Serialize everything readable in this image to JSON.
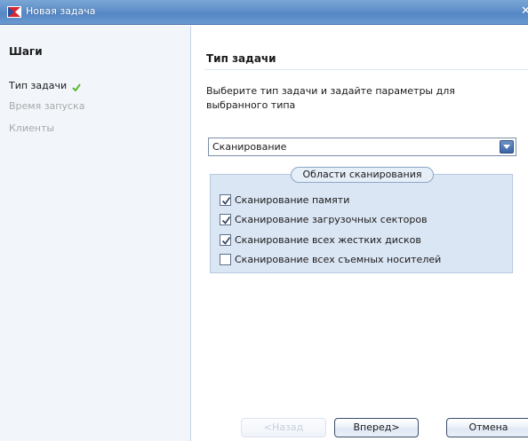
{
  "window": {
    "title": "Новая задача",
    "icon": "app-flag-icon"
  },
  "sidebar": {
    "title": "Шаги",
    "steps": [
      {
        "label": "Тип задачи",
        "state": "done",
        "icon": "checkmark-icon"
      },
      {
        "label": "Время запуска",
        "state": "disabled"
      },
      {
        "label": "Клиенты",
        "state": "disabled"
      }
    ]
  },
  "main": {
    "title": "Тип задачи",
    "description": "Выберите тип задачи и задайте параметры для выбранного типа",
    "task_type": {
      "selected": "Сканирование",
      "icon": "chevron-down-icon"
    },
    "scan_areas": {
      "legend": "Области сканирования",
      "options": [
        {
          "label": "Сканирование памяти",
          "checked": true
        },
        {
          "label": "Сканирование загрузочных секторов",
          "checked": true
        },
        {
          "label": "Сканирование всех жестких дисков",
          "checked": true
        },
        {
          "label": "Сканирование всех съемных носителей",
          "checked": false
        }
      ]
    }
  },
  "footer": {
    "back_label": "<Назад",
    "back_enabled": false,
    "next_label": "Вперед>",
    "cancel_label": "Отмена"
  },
  "colors": {
    "titlebar": "#5f8fc9",
    "sidebar_bg": "#f2f6fb",
    "group_bg": "#dbe6f4",
    "disabled_text": "#a8a8a8",
    "check_green": "#5cb82e"
  }
}
